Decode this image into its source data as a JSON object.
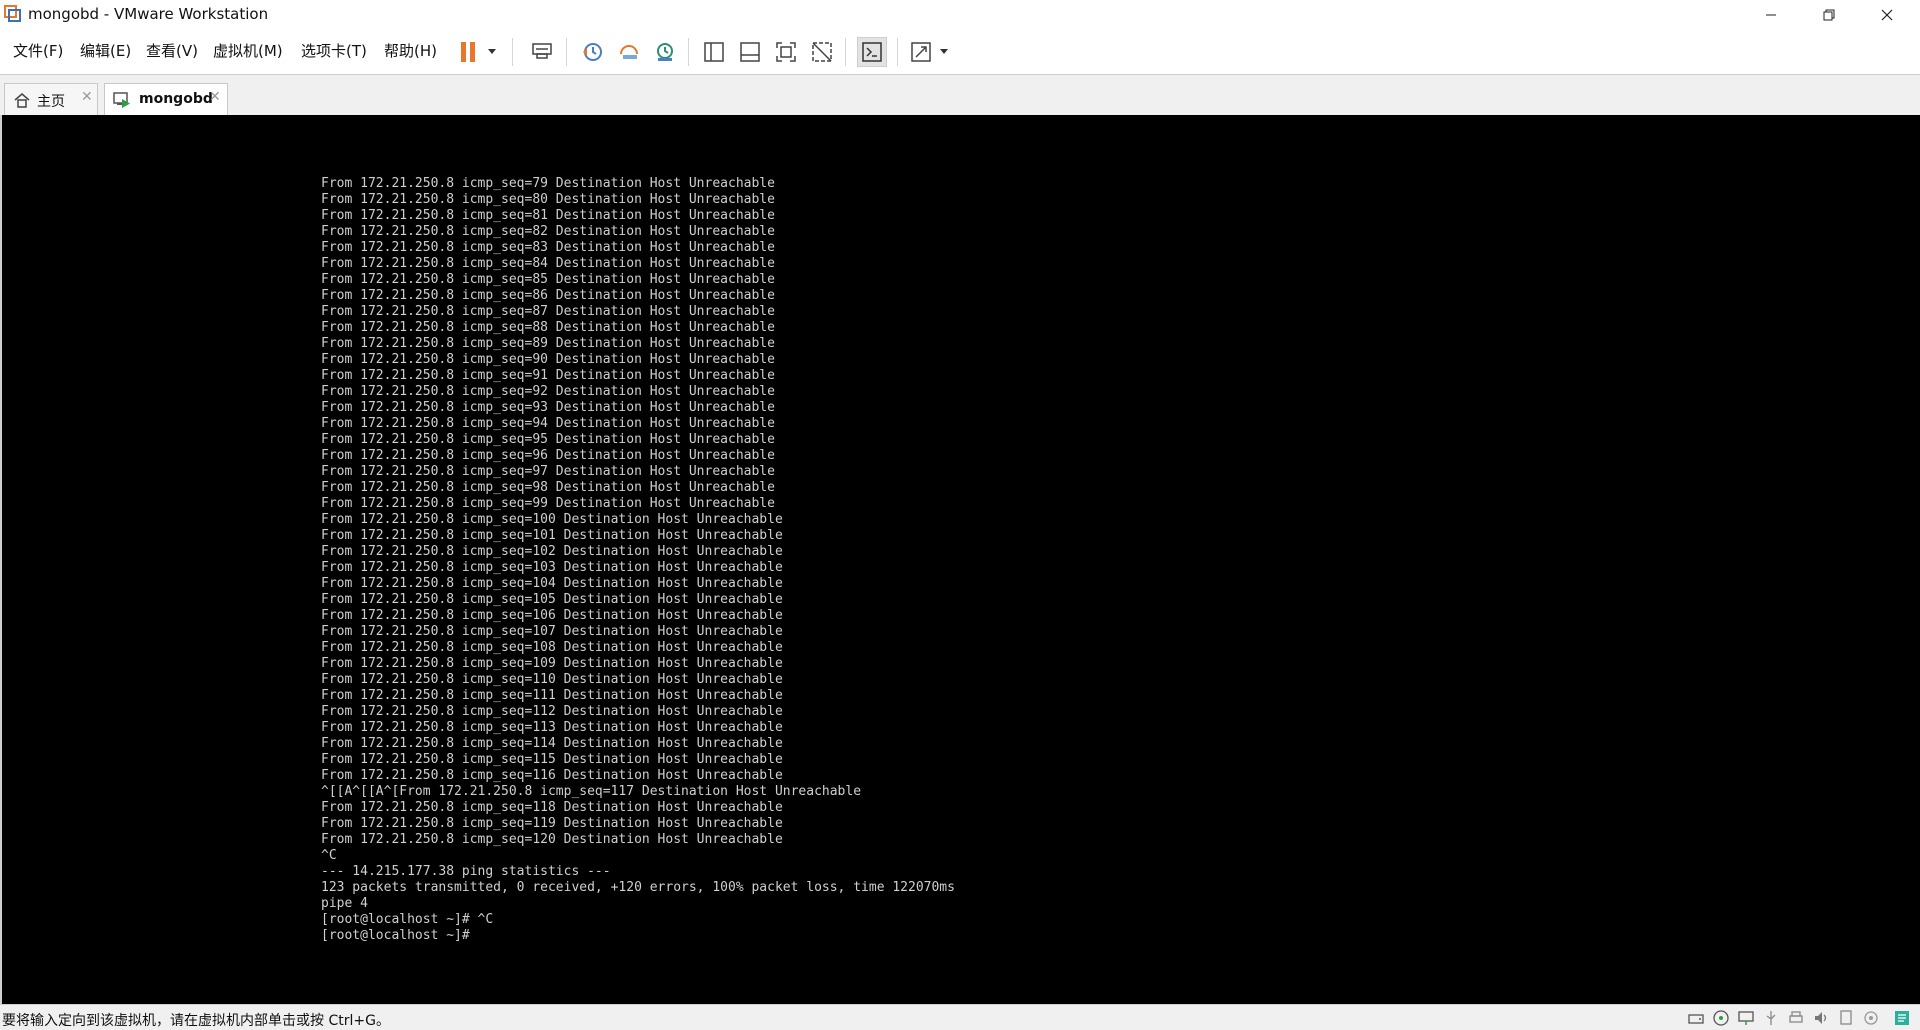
{
  "window": {
    "title": "mongobd - VMware Workstation"
  },
  "menu": {
    "items": [
      "文件(F)",
      "编辑(E)",
      "查看(V)",
      "虚拟机(M)",
      "选项卡(T)",
      "帮助(H)"
    ]
  },
  "toolbar": {
    "icons": [
      "pause-icon",
      "send-ctrl-alt-del-icon",
      "snapshot-icon",
      "revert-snapshot-icon",
      "snapshot-manager-icon",
      "show-library-icon",
      "show-thumbnail-bar-icon",
      "full-screen-icon",
      "unity-icon",
      "console-view-icon",
      "stretch-guest-icon"
    ],
    "accent_color": "#e8772b"
  },
  "tabs": [
    {
      "label": "主页",
      "active": false
    },
    {
      "label": "mongobd",
      "active": true
    }
  ],
  "terminal": {
    "source_ip": "172.21.250.8",
    "lines": [
      "From 172.21.250.8 icmp_seq=79 Destination Host Unreachable",
      "From 172.21.250.8 icmp_seq=80 Destination Host Unreachable",
      "From 172.21.250.8 icmp_seq=81 Destination Host Unreachable",
      "From 172.21.250.8 icmp_seq=82 Destination Host Unreachable",
      "From 172.21.250.8 icmp_seq=83 Destination Host Unreachable",
      "From 172.21.250.8 icmp_seq=84 Destination Host Unreachable",
      "From 172.21.250.8 icmp_seq=85 Destination Host Unreachable",
      "From 172.21.250.8 icmp_seq=86 Destination Host Unreachable",
      "From 172.21.250.8 icmp_seq=87 Destination Host Unreachable",
      "From 172.21.250.8 icmp_seq=88 Destination Host Unreachable",
      "From 172.21.250.8 icmp_seq=89 Destination Host Unreachable",
      "From 172.21.250.8 icmp_seq=90 Destination Host Unreachable",
      "From 172.21.250.8 icmp_seq=91 Destination Host Unreachable",
      "From 172.21.250.8 icmp_seq=92 Destination Host Unreachable",
      "From 172.21.250.8 icmp_seq=93 Destination Host Unreachable",
      "From 172.21.250.8 icmp_seq=94 Destination Host Unreachable",
      "From 172.21.250.8 icmp_seq=95 Destination Host Unreachable",
      "From 172.21.250.8 icmp_seq=96 Destination Host Unreachable",
      "From 172.21.250.8 icmp_seq=97 Destination Host Unreachable",
      "From 172.21.250.8 icmp_seq=98 Destination Host Unreachable",
      "From 172.21.250.8 icmp_seq=99 Destination Host Unreachable",
      "From 172.21.250.8 icmp_seq=100 Destination Host Unreachable",
      "From 172.21.250.8 icmp_seq=101 Destination Host Unreachable",
      "From 172.21.250.8 icmp_seq=102 Destination Host Unreachable",
      "From 172.21.250.8 icmp_seq=103 Destination Host Unreachable",
      "From 172.21.250.8 icmp_seq=104 Destination Host Unreachable",
      "From 172.21.250.8 icmp_seq=105 Destination Host Unreachable",
      "From 172.21.250.8 icmp_seq=106 Destination Host Unreachable",
      "From 172.21.250.8 icmp_seq=107 Destination Host Unreachable",
      "From 172.21.250.8 icmp_seq=108 Destination Host Unreachable",
      "From 172.21.250.8 icmp_seq=109 Destination Host Unreachable",
      "From 172.21.250.8 icmp_seq=110 Destination Host Unreachable",
      "From 172.21.250.8 icmp_seq=111 Destination Host Unreachable",
      "From 172.21.250.8 icmp_seq=112 Destination Host Unreachable",
      "From 172.21.250.8 icmp_seq=113 Destination Host Unreachable",
      "From 172.21.250.8 icmp_seq=114 Destination Host Unreachable",
      "From 172.21.250.8 icmp_seq=115 Destination Host Unreachable",
      "From 172.21.250.8 icmp_seq=116 Destination Host Unreachable",
      "^[[A^[[A^[From 172.21.250.8 icmp_seq=117 Destination Host Unreachable",
      "From 172.21.250.8 icmp_seq=118 Destination Host Unreachable",
      "From 172.21.250.8 icmp_seq=119 Destination Host Unreachable",
      "From 172.21.250.8 icmp_seq=120 Destination Host Unreachable",
      "^C",
      "--- 14.215.177.38 ping statistics ---",
      "123 packets transmitted, 0 received, +120 errors, 100% packet loss, time 122070ms",
      "pipe 4",
      "[root@localhost ~]# ^C",
      "[root@localhost ~]#"
    ]
  },
  "statusbar": {
    "text": "要将输入定向到该虚拟机，请在虚拟机内部单击或按 Ctrl+G。",
    "icons": [
      "hard-disk-icon",
      "cd-dvd-icon",
      "network-adapter-icon",
      "usb-icon",
      "printer-icon",
      "sound-card-icon",
      "display-icon",
      "camera-icon",
      "message-log-icon"
    ]
  }
}
